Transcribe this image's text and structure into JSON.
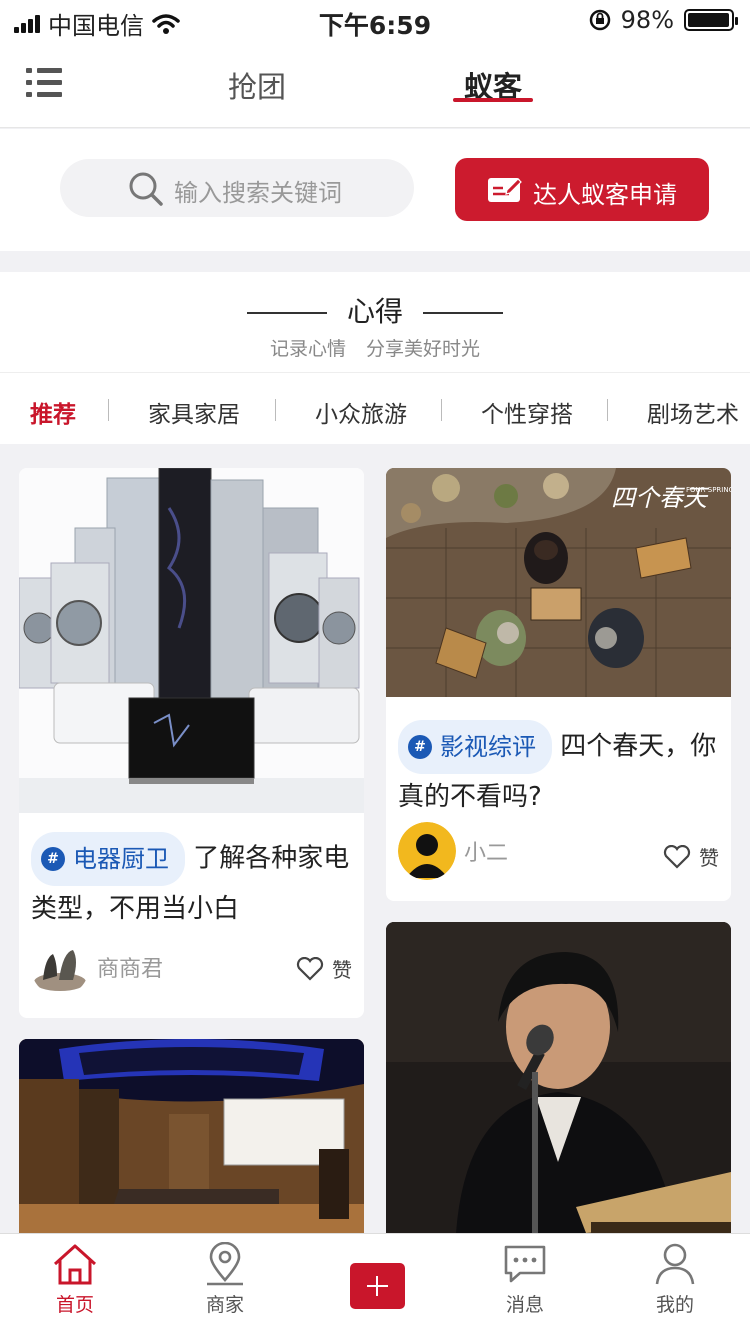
{
  "status": {
    "carrier": "中国电信",
    "time": "下午6:59",
    "battery": "98%",
    "battery_level": 0.98
  },
  "nav": {
    "tabs": [
      "抢团",
      "蚁客"
    ],
    "active_tab": "蚁客"
  },
  "search": {
    "placeholder": "输入搜索关键词",
    "apply_label": "达人蚁客申请"
  },
  "section": {
    "title": "心得",
    "subtitle_left": "记录心情",
    "subtitle_right": "分享美好时光"
  },
  "categories": [
    "推荐",
    "家具家居",
    "小众旅游",
    "个性穿搭",
    "剧场艺术"
  ],
  "cards": [
    {
      "tag": "电器厨卫",
      "title": "了解各种家电类型，不用当小白",
      "author": "商商君",
      "like": "赞"
    },
    {
      "tag": "影视综评",
      "title": "四个春天，你真的不看吗?",
      "author": "小二",
      "like": "赞"
    }
  ],
  "poster_text": {
    "title": "四个春天",
    "sub": "FOUR SPRINGS"
  },
  "tabbar": [
    "首页",
    "商家",
    "消息",
    "我的"
  ],
  "colors": {
    "accent": "#c9162b",
    "tag_blue": "#1b59b5"
  }
}
